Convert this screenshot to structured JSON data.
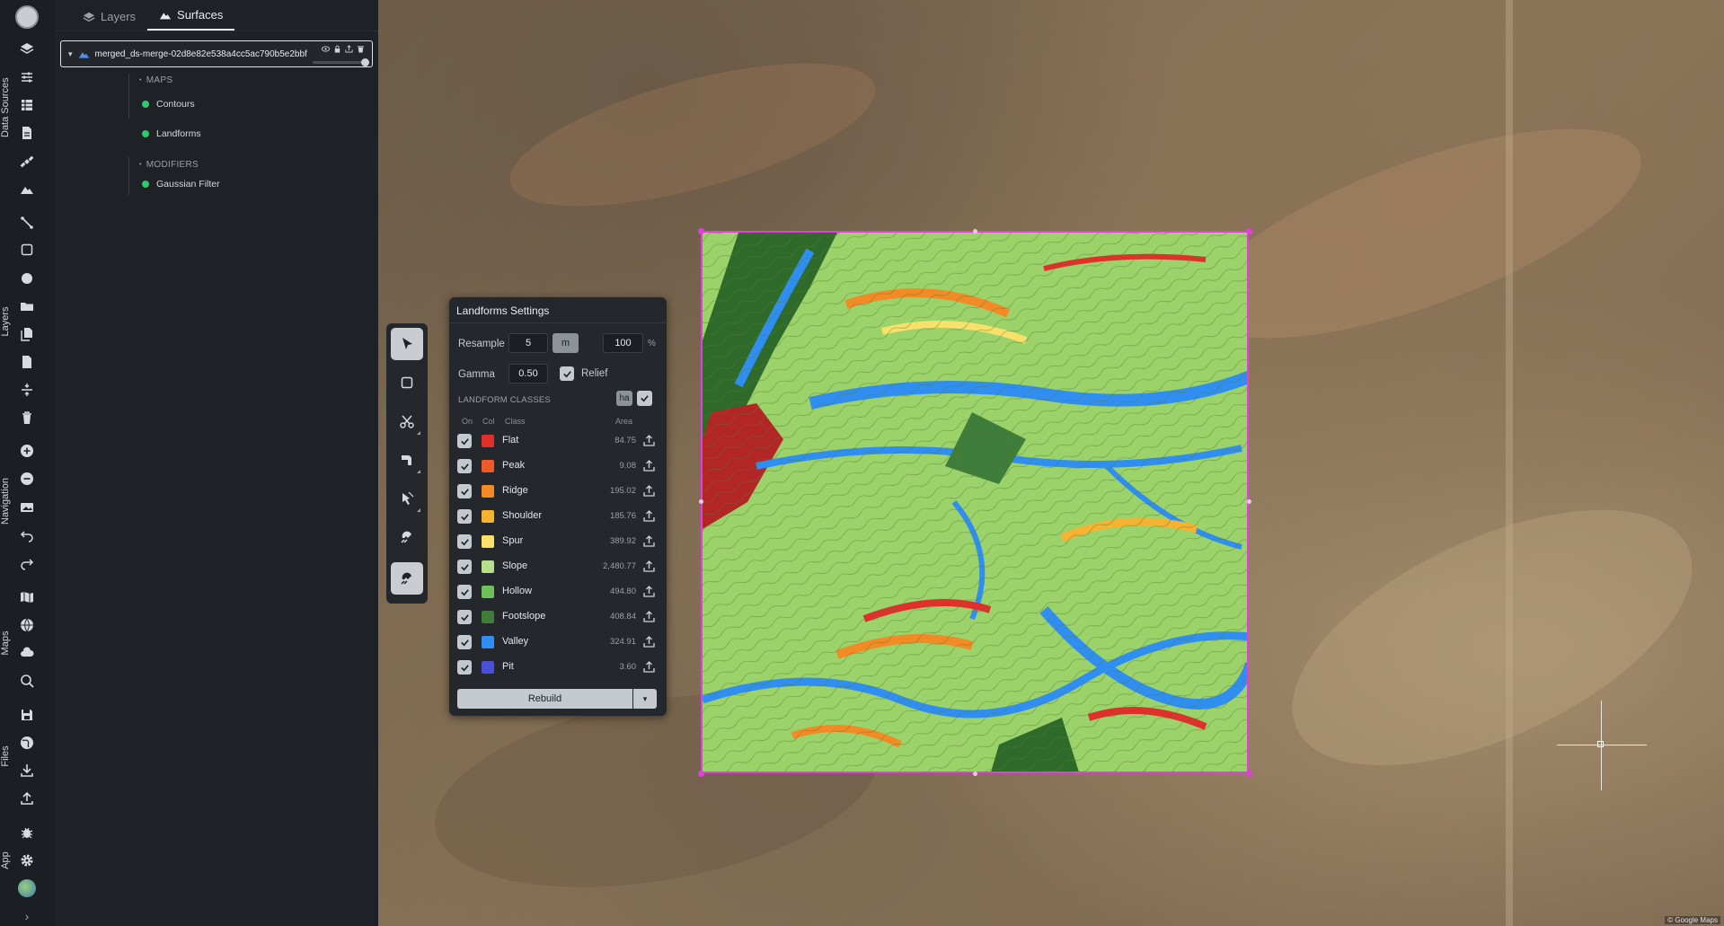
{
  "rail": {
    "labels": [
      "Data Sources",
      "Layers",
      "Navigation",
      "Maps",
      "Files",
      "App"
    ],
    "expand_glyph": "›"
  },
  "panel": {
    "tabs": [
      {
        "label": "Layers",
        "icon": "layers-icon",
        "active": false
      },
      {
        "label": "Surfaces",
        "icon": "mountain-icon",
        "active": true
      }
    ],
    "surface": {
      "name": "merged_ds-merge-02d8e82e538a4cc5ac790b5e2bbf",
      "expand_glyph": "▾"
    },
    "maps_section": "MAPS",
    "maps": [
      "Contours",
      "Landforms"
    ],
    "modifiers_section": "MODIFIERS",
    "modifiers": [
      "Gaussian Filter"
    ],
    "status_color": "#2fc86b"
  },
  "map": {
    "copyright": "© Google Maps"
  },
  "settings": {
    "title": "Landforms Settings",
    "resample_label": "Resample",
    "resample_value": "5",
    "resample_unit": "m",
    "resample_percent": "100",
    "percent_symbol": "%",
    "gamma_label": "Gamma",
    "gamma_value": "0.50",
    "relief_label": "Relief",
    "relief_checked": true,
    "classes_heading": "LANDFORM CLASSES",
    "area_unit": "ha",
    "columns": {
      "on": "On",
      "col": "Col",
      "class": "Class",
      "area": "Area"
    },
    "classes": [
      {
        "name": "Flat",
        "color": "#e0302c",
        "area": "84.75",
        "on": true
      },
      {
        "name": "Peak",
        "color": "#ee5a2a",
        "area": "9.08",
        "on": true
      },
      {
        "name": "Ridge",
        "color": "#f28a26",
        "area": "195.02",
        "on": true
      },
      {
        "name": "Shoulder",
        "color": "#f5b331",
        "area": "185.76",
        "on": true
      },
      {
        "name": "Spur",
        "color": "#f7e16a",
        "area": "389.92",
        "on": true
      },
      {
        "name": "Slope",
        "color": "#b8e08a",
        "area": "2,480.77",
        "on": true
      },
      {
        "name": "Hollow",
        "color": "#6fbf5a",
        "area": "494.80",
        "on": true
      },
      {
        "name": "Footslope",
        "color": "#3e7d3a",
        "area": "408.84",
        "on": true
      },
      {
        "name": "Valley",
        "color": "#2f8ef0",
        "area": "324.91",
        "on": true
      },
      {
        "name": "Pit",
        "color": "#4a4fd8",
        "area": "3.60",
        "on": true
      }
    ],
    "rebuild_label": "Rebuild",
    "dropdown_glyph": "▾"
  }
}
